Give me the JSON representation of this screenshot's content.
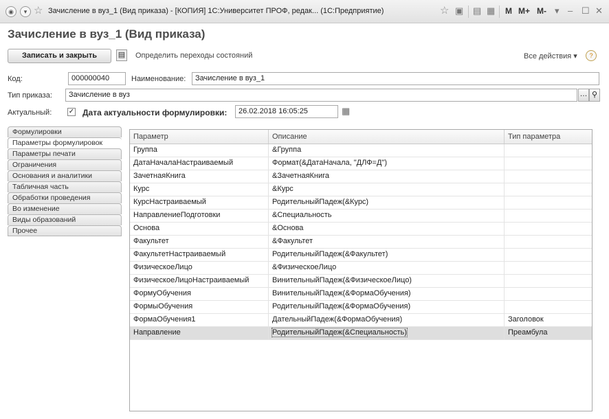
{
  "window": {
    "title": "Зачисление в вуз_1 (Вид приказа) - [КОПИЯ] 1С:Университет ПРОФ, редак... (1С:Предприятие)",
    "m_labels": [
      "M",
      "M+",
      "M-"
    ]
  },
  "form": {
    "title": "Зачисление в вуз_1 (Вид приказа)"
  },
  "toolbar": {
    "save_close": "Записать и закрыть",
    "transitions": "Определить переходы состояний",
    "all_actions": "Все действия ▾",
    "help": "?"
  },
  "fields": {
    "code_label": "Код:",
    "code_value": "000000040",
    "name_label": "Наименование:",
    "name_value": "Зачисление в вуз_1",
    "order_type_label": "Тип приказа:",
    "order_type_value": "Зачисление в вуз",
    "actual_label": "Актуальный:",
    "actual_checked": true,
    "date_label": "Дата актуальности формулировки:",
    "date_value": "26.02.2018 16:05:25"
  },
  "tabs": [
    {
      "label": "Формулировки"
    },
    {
      "label": "Параметры формулировок"
    },
    {
      "label": "Параметры печати"
    },
    {
      "label": "Ограничения"
    },
    {
      "label": "Основания и аналитики"
    },
    {
      "label": "Табличная часть"
    },
    {
      "label": "Обработки проведения"
    },
    {
      "label": "Во изменение"
    },
    {
      "label": "Виды образований"
    },
    {
      "label": "Прочее"
    }
  ],
  "active_tab": 1,
  "table": {
    "columns": [
      "Параметр",
      "Описание",
      "Тип параметра"
    ],
    "rows": [
      [
        "Группа",
        "&Группа",
        ""
      ],
      [
        "ДатаНачалаНастраиваемый",
        "Формат(&ДатаНачала, \"ДЛФ=Д\")",
        ""
      ],
      [
        "ЗачетнаяКнига",
        "&ЗачетнаяКнига",
        ""
      ],
      [
        "Курс",
        "&Курс",
        ""
      ],
      [
        "КурсНастраиваемый",
        "РодительныйПадеж(&Курс)",
        ""
      ],
      [
        "НаправлениеПодготовки",
        "&Специальность",
        ""
      ],
      [
        "Основа",
        "&Основа",
        ""
      ],
      [
        "Факультет",
        "&Факультет",
        ""
      ],
      [
        "ФакультетНастраиваемый",
        "РодительныйПадеж(&Факультет)",
        ""
      ],
      [
        "ФизическоеЛицо",
        "&ФизическоеЛицо",
        ""
      ],
      [
        "ФизическоеЛицоНастраиваемый",
        "ВинительныйПадеж(&ФизическоеЛицо)",
        ""
      ],
      [
        "ФормуОбучения",
        "ВинительныйПадеж(&ФормаОбучения)",
        ""
      ],
      [
        "ФормыОбучения",
        "РодительныйПадеж(&ФормаОбучения)",
        ""
      ],
      [
        "ФормаОбучения1",
        "ДательныйПадеж(&ФормаОбучения)",
        "Заголовок"
      ],
      [
        "Направление",
        "РодительныйПадеж(&Специальность)",
        "Преамбула"
      ]
    ],
    "selected_row": 14
  }
}
